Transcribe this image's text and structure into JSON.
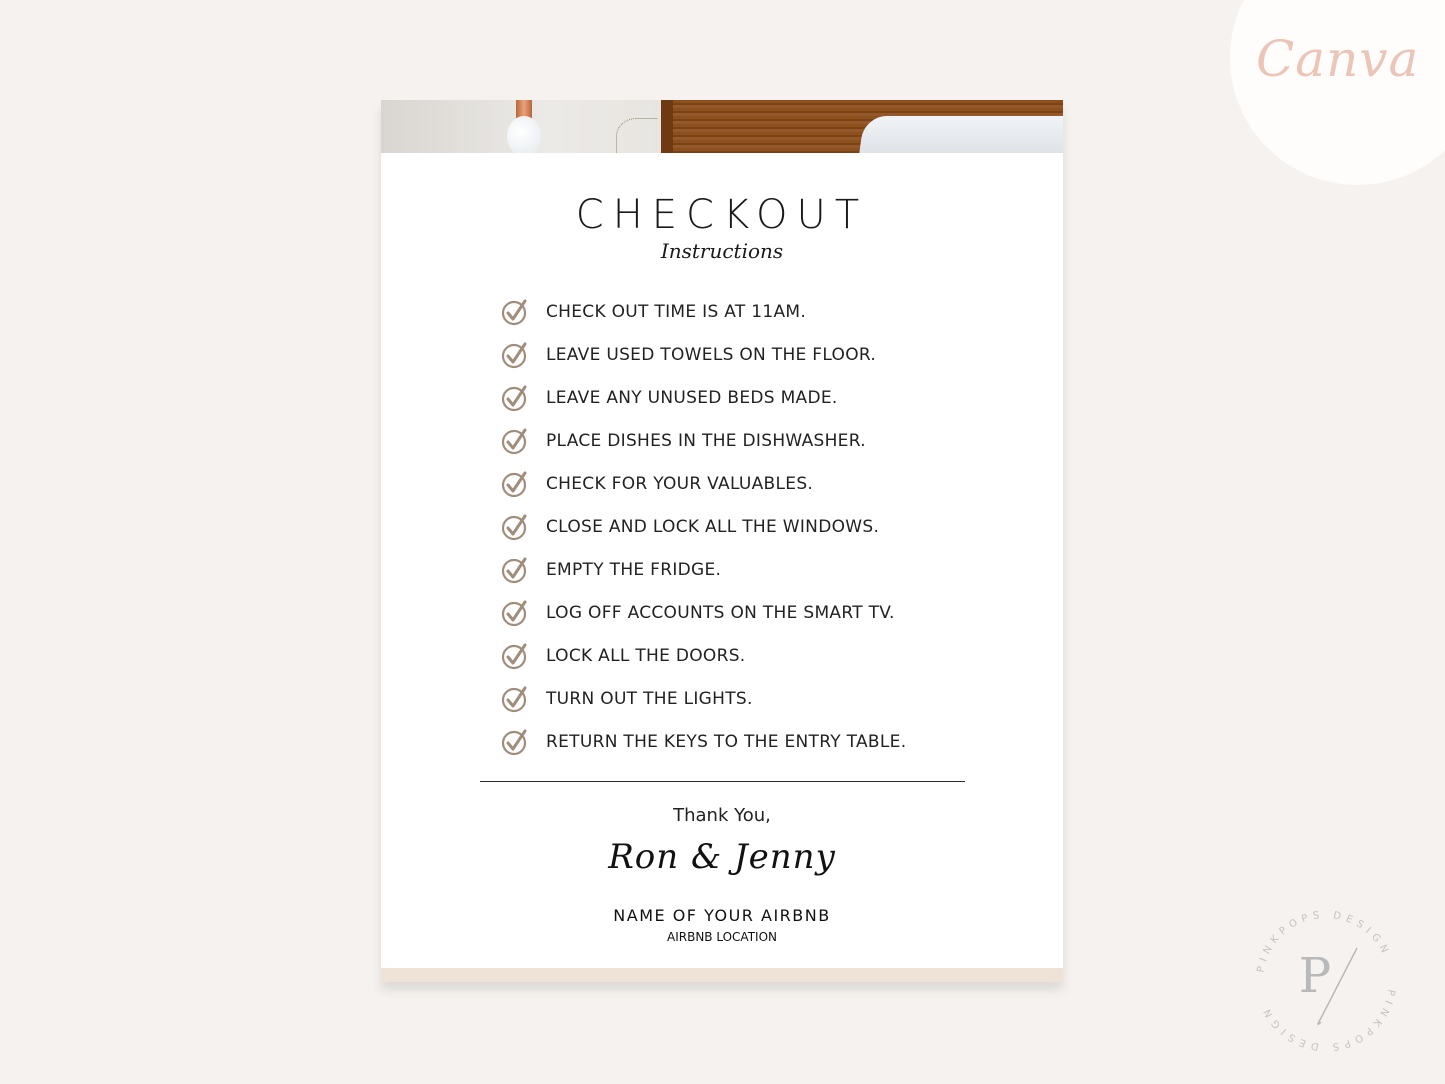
{
  "brand": {
    "canva_logo": "Canva",
    "watermark_text": "PINKPOPS DESIGN",
    "watermark_monogram": "P",
    "colors": {
      "background": "#f6f2ef",
      "canva_pink": "#ebc5b7",
      "check_accent": "#a08d7b",
      "footer_band": "#efe2d6",
      "watermark_gray": "#c3c3c3"
    }
  },
  "card": {
    "header_image": "bedroom-photo",
    "title": "CHECKOUT",
    "subtitle": "Instructions",
    "checklist_icon": "circle-check-icon",
    "items": [
      "CHECK OUT TIME IS AT 11AM.",
      "LEAVE USED TOWELS ON THE FLOOR.",
      "LEAVE ANY UNUSED BEDS MADE.",
      "PLACE DISHES IN THE DISHWASHER.",
      "CHECK FOR YOUR VALUABLES.",
      "CLOSE AND LOCK ALL THE WINDOWS.",
      "EMPTY THE FRIDGE.",
      "LOG OFF ACCOUNTS ON THE SMART TV.",
      "LOCK ALL THE DOORS.",
      "TURN OUT THE LIGHTS.",
      "RETURN THE KEYS TO THE ENTRY TABLE."
    ],
    "closing": "Thank You,",
    "signature": "Ron & Jenny",
    "business_name": "NAME OF YOUR AIRBNB",
    "location": "AIRBNB LOCATION"
  }
}
